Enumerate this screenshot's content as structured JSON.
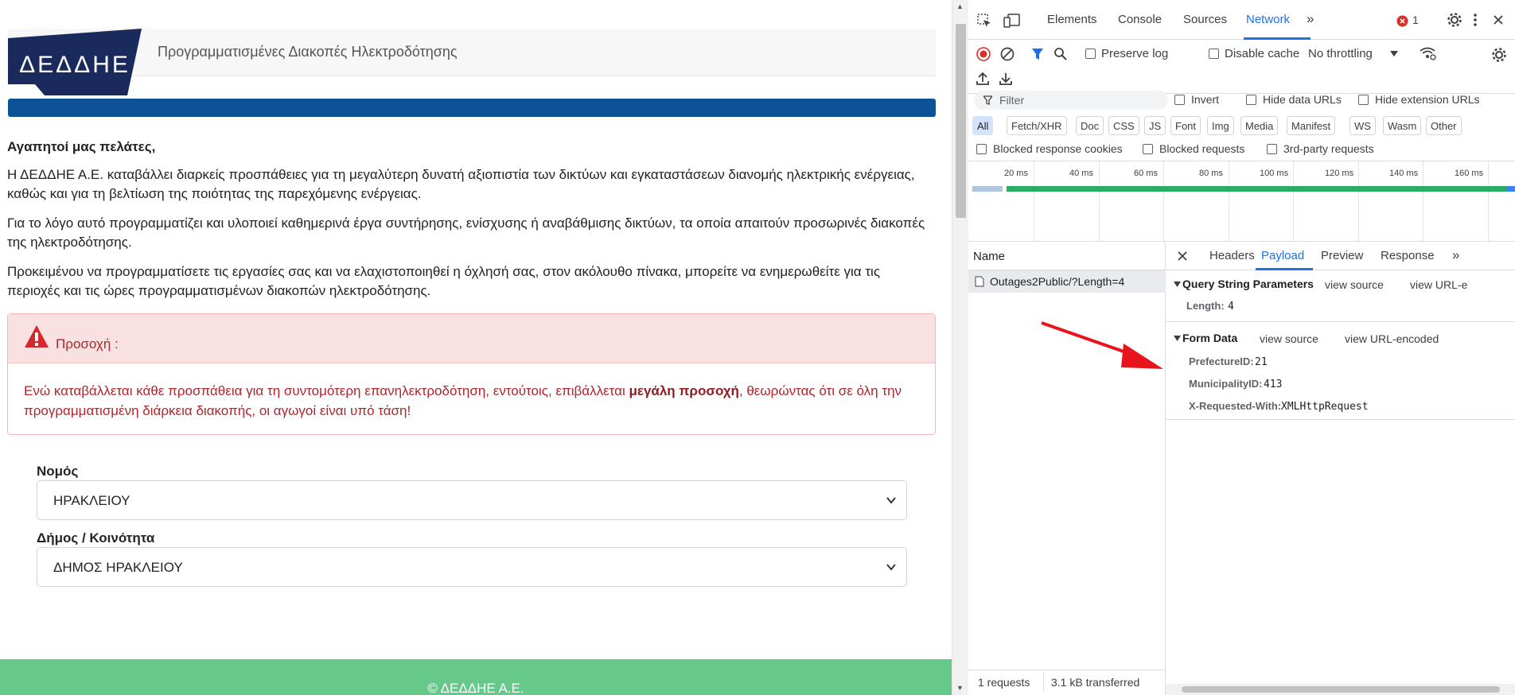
{
  "site": {
    "logo_text": "ΔΕΔΔΗΕ",
    "title": "Προγραμματισμένες Διακοπές Ηλεκτροδότησης",
    "greeting": "Αγαπητοί μας πελάτες,",
    "para1": "Η ΔΕΔΔΗΕ Α.Ε. καταβάλλει διαρκείς προσπάθειες για τη μεγαλύτερη δυνατή αξιοπιστία των δικτύων και εγκαταστάσεων διανομής ηλεκτρικής ενέργειας, καθώς και για τη βελτίωση της ποιότητας της παρεχόμενης ενέργειας.",
    "para2": "Για το λόγο αυτό προγραμματίζει και υλοποιεί καθημερινά έργα συντήρησης, ενίσχυσης ή αναβάθμισης δικτύων, τα οποία απαιτούν προσωρινές διακοπές της ηλεκτροδότησης.",
    "para3": "Προκειμένου να προγραμματίσετε τις εργασίες σας και να ελαχιστοποιηθεί η όχλησή σας, στον ακόλουθο πίνακα, μπορείτε να ενημερωθείτε για τις περιοχές και τις ώρες προγραμματισμένων διακοπών ηλεκτροδότησης.",
    "alert": {
      "title": "Προσοχή :",
      "text_before": "Ενώ καταβάλλεται κάθε προσπάθεια για τη συντομότερη επανηλεκτροδότηση, εντούτοις, επιβάλλεται ",
      "text_bold": "μεγάλη προσοχή",
      "text_after": ", θεωρώντας ότι σε όλη την προγραμματισμένη διάρκεια διακοπής, οι αγωγοί είναι υπό τάση!"
    },
    "prefecture_label": "Νομός",
    "prefecture_value": "ΗΡΑΚΛΕΙΟΥ",
    "municipality_label": "Δήμος / Κοινότητα",
    "municipality_value": "ΔΗΜΟΣ ΗΡΑΚΛΕΙΟΥ",
    "footer": "© ΔΕΔΔΗΕ Α.Ε."
  },
  "devtools": {
    "tabs": [
      "Elements",
      "Console",
      "Sources",
      "Network"
    ],
    "active_tab": "Network",
    "error_count": "1",
    "preserve_log": "Preserve log",
    "disable_cache": "Disable cache",
    "throttling": "No throttling",
    "filter_placeholder": "Filter",
    "invert": "Invert",
    "hide_data_urls": "Hide data URLs",
    "hide_extension_urls": "Hide extension URLs",
    "type_filters": [
      "All",
      "Fetch/XHR",
      "Doc",
      "CSS",
      "JS",
      "Font",
      "Img",
      "Media",
      "Manifest",
      "WS",
      "Wasm",
      "Other"
    ],
    "blocked_cookies": "Blocked response cookies",
    "blocked_requests": "Blocked requests",
    "third_party": "3rd-party requests",
    "timeline_ticks": [
      "20 ms",
      "40 ms",
      "60 ms",
      "80 ms",
      "100 ms",
      "120 ms",
      "140 ms",
      "160 ms"
    ],
    "name_header": "Name",
    "request_name": "Outages2Public/?Length=4",
    "status_requests": "1 requests",
    "status_transferred": "3.1 kB transferred",
    "detail_tabs": [
      "Headers",
      "Payload",
      "Preview",
      "Response"
    ],
    "active_detail_tab": "Payload",
    "qsp_title": "Query String Parameters",
    "view_source": "view source",
    "view_url_encoded": "view URL-encoded",
    "view_url_cut": "view URL-e",
    "qsp_key": "Length:",
    "qsp_val": "4",
    "form_title": "Form Data",
    "form_rows": [
      {
        "key": "PrefectureID:",
        "val": "21"
      },
      {
        "key": "MunicipalityID:",
        "val": "413"
      },
      {
        "key": "X-Requested-With:",
        "val": "XMLHttpRequest"
      }
    ],
    "colors": {
      "accent": "#1a73e8",
      "error": "#d93025",
      "arrow": "#e8141d"
    }
  }
}
